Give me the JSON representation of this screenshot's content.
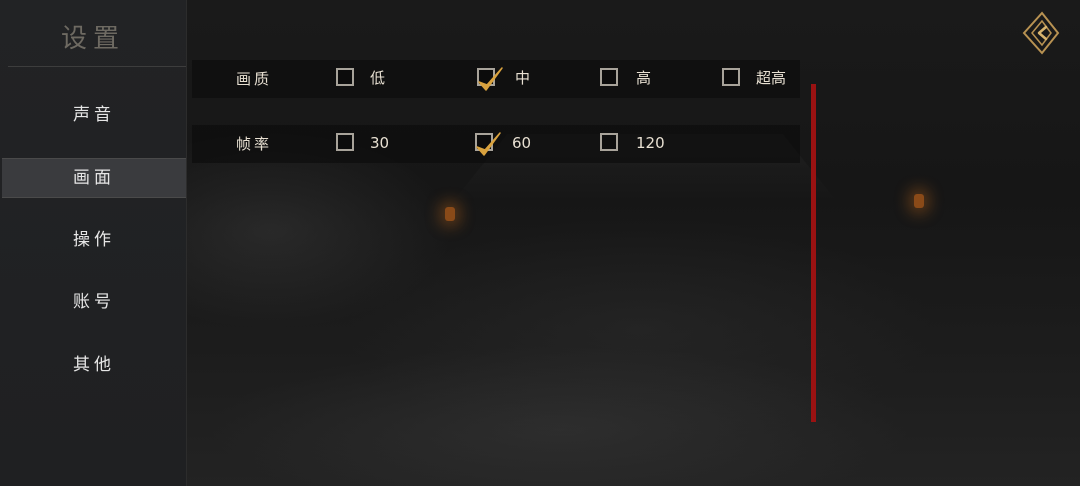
{
  "sidebar": {
    "title": "设置",
    "items": [
      {
        "label": "声音"
      },
      {
        "label": "画面"
      },
      {
        "label": "操作"
      },
      {
        "label": "账号"
      },
      {
        "label": "其他"
      }
    ],
    "active_index": 1
  },
  "settings": {
    "quality": {
      "label": "画质",
      "options": [
        {
          "label": "低",
          "checked": false
        },
        {
          "label": "中",
          "checked": true
        },
        {
          "label": "高",
          "checked": false
        },
        {
          "label": "超高",
          "checked": false
        }
      ]
    },
    "framerate": {
      "label": "帧率",
      "options": [
        {
          "label": "30",
          "checked": false
        },
        {
          "label": "60",
          "checked": true
        },
        {
          "label": "120",
          "checked": false
        }
      ]
    }
  },
  "colors": {
    "accent_gold": "#d9a23e",
    "scrollbar_red": "#9a1212",
    "active_nav_bg": "#3a3b3e"
  },
  "icons": {
    "back": "back-diamond-arrow-icon",
    "check": "checkmark-icon"
  }
}
